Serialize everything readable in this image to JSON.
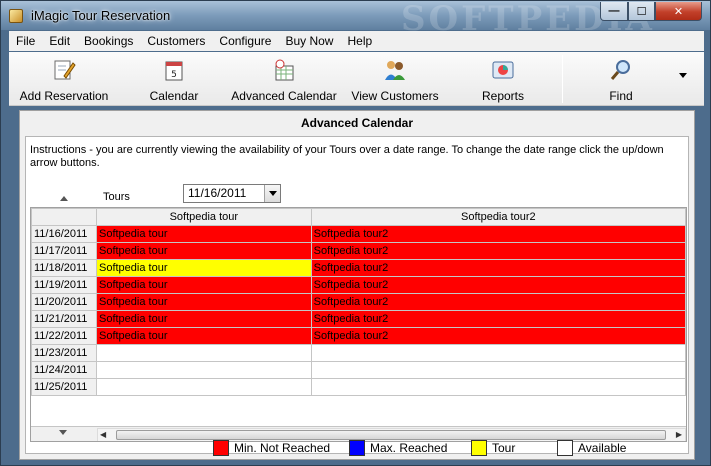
{
  "window": {
    "title": "iMagic Tour Reservation",
    "watermark": "SOFTPEDIA"
  },
  "window_controls": {
    "minimize": "—",
    "maximize": "☐",
    "close": "✕"
  },
  "menu": [
    "File",
    "Edit",
    "Bookings",
    "Customers",
    "Configure",
    "Buy Now",
    "Help"
  ],
  "toolbar": {
    "add_reservation": "Add Reservation",
    "calendar": "Calendar",
    "advanced_calendar": "Advanced Calendar",
    "view_customers": "View Customers",
    "reports": "Reports",
    "find": "Find",
    "overflow_icon": "chevron-down-icon"
  },
  "panel": {
    "title": "Advanced Calendar",
    "instructions": "Instructions - you are currently viewing the availability of your Tours over a date range. To change the date range click the up/down arrow buttons.",
    "tours_label": "Tours",
    "selected_date": "11/16/2011"
  },
  "grid": {
    "columns": [
      "Softpedia tour",
      "Softpedia tour2"
    ],
    "rows": [
      {
        "date": "11/16/2011",
        "cells": [
          {
            "text": "Softpedia tour",
            "status": "min"
          },
          {
            "text": "Softpedia tour2",
            "status": "min"
          }
        ]
      },
      {
        "date": "11/17/2011",
        "cells": [
          {
            "text": "Softpedia tour",
            "status": "min"
          },
          {
            "text": "Softpedia tour2",
            "status": "min"
          }
        ]
      },
      {
        "date": "11/18/2011",
        "cells": [
          {
            "text": "Softpedia tour",
            "status": "tour"
          },
          {
            "text": "Softpedia tour2",
            "status": "min"
          }
        ]
      },
      {
        "date": "11/19/2011",
        "cells": [
          {
            "text": "Softpedia tour",
            "status": "min"
          },
          {
            "text": "Softpedia tour2",
            "status": "min"
          }
        ]
      },
      {
        "date": "11/20/2011",
        "cells": [
          {
            "text": "Softpedia tour",
            "status": "min"
          },
          {
            "text": "Softpedia tour2",
            "status": "min"
          }
        ]
      },
      {
        "date": "11/21/2011",
        "cells": [
          {
            "text": "Softpedia tour",
            "status": "min"
          },
          {
            "text": "Softpedia tour2",
            "status": "min"
          }
        ]
      },
      {
        "date": "11/22/2011",
        "cells": [
          {
            "text": "Softpedia tour",
            "status": "min"
          },
          {
            "text": "Softpedia tour2",
            "status": "min"
          }
        ]
      },
      {
        "date": "11/23/2011",
        "cells": [
          {
            "text": "",
            "status": "available"
          },
          {
            "text": "",
            "status": "available"
          }
        ]
      },
      {
        "date": "11/24/2011",
        "cells": [
          {
            "text": "",
            "status": "available"
          },
          {
            "text": "",
            "status": "available"
          }
        ]
      },
      {
        "date": "11/25/2011",
        "cells": [
          {
            "text": "",
            "status": "available"
          },
          {
            "text": "",
            "status": "available"
          }
        ]
      }
    ]
  },
  "status_colors": {
    "min": "#ff0000",
    "max": "#0000ff",
    "tour": "#ffff00",
    "available": "#ffffff"
  },
  "legend": [
    {
      "label": "Min. Not Reached",
      "color": "#ff0000"
    },
    {
      "label": "Max. Reached",
      "color": "#0000ff"
    },
    {
      "label": "Tour",
      "color": "#ffff00"
    },
    {
      "label": "Available",
      "color": "#ffffff"
    }
  ]
}
